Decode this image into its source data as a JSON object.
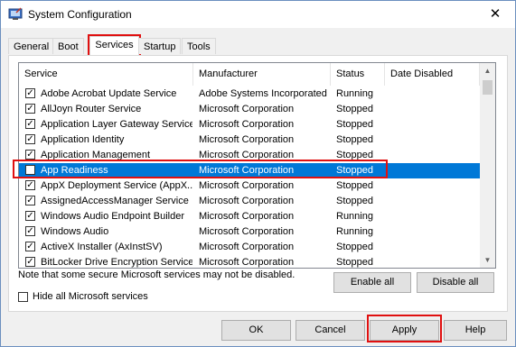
{
  "window": {
    "title": "System Configuration",
    "close_glyph": "✕",
    "icon": "msconfig-icon"
  },
  "tabs": [
    {
      "label": "General"
    },
    {
      "label": "Boot"
    },
    {
      "label": "Services"
    },
    {
      "label": "Startup"
    },
    {
      "label": "Tools"
    }
  ],
  "active_tab": "Services",
  "columns": [
    "Service",
    "Manufacturer",
    "Status",
    "Date Disabled"
  ],
  "rows": [
    {
      "service": "Adobe Acrobat Update Service",
      "manufacturer": "Adobe Systems Incorporated",
      "status": "Running",
      "checked": true
    },
    {
      "service": "AllJoyn Router Service",
      "manufacturer": "Microsoft Corporation",
      "status": "Stopped",
      "checked": true
    },
    {
      "service": "Application Layer Gateway Service",
      "manufacturer": "Microsoft Corporation",
      "status": "Stopped",
      "checked": true
    },
    {
      "service": "Application Identity",
      "manufacturer": "Microsoft Corporation",
      "status": "Stopped",
      "checked": true
    },
    {
      "service": "Application Management",
      "manufacturer": "Microsoft Corporation",
      "status": "Stopped",
      "checked": true
    },
    {
      "service": "App Readiness",
      "manufacturer": "Microsoft Corporation",
      "status": "Stopped",
      "checked": false,
      "selected": true
    },
    {
      "service": "AppX Deployment Service (AppX...",
      "manufacturer": "Microsoft Corporation",
      "status": "Stopped",
      "checked": true
    },
    {
      "service": "AssignedAccessManager Service",
      "manufacturer": "Microsoft Corporation",
      "status": "Stopped",
      "checked": true
    },
    {
      "service": "Windows Audio Endpoint Builder",
      "manufacturer": "Microsoft Corporation",
      "status": "Running",
      "checked": true
    },
    {
      "service": "Windows Audio",
      "manufacturer": "Microsoft Corporation",
      "status": "Running",
      "checked": true
    },
    {
      "service": "ActiveX Installer (AxInstSV)",
      "manufacturer": "Microsoft Corporation",
      "status": "Stopped",
      "checked": true
    },
    {
      "service": "BitLocker Drive Encryption Service",
      "manufacturer": "Microsoft Corporation",
      "status": "Stopped",
      "checked": true
    }
  ],
  "note": "Note that some secure Microsoft services may not be disabled.",
  "enable_all": "Enable all",
  "disable_all": "Disable all",
  "hide_ms": {
    "label": "Hide all Microsoft services",
    "checked": false
  },
  "footer": {
    "ok": "OK",
    "cancel": "Cancel",
    "apply": "Apply",
    "help": "Help"
  },
  "check_glyph": "✓",
  "colors": {
    "selection": "#0078d7",
    "highlight_box": "#e01010"
  }
}
